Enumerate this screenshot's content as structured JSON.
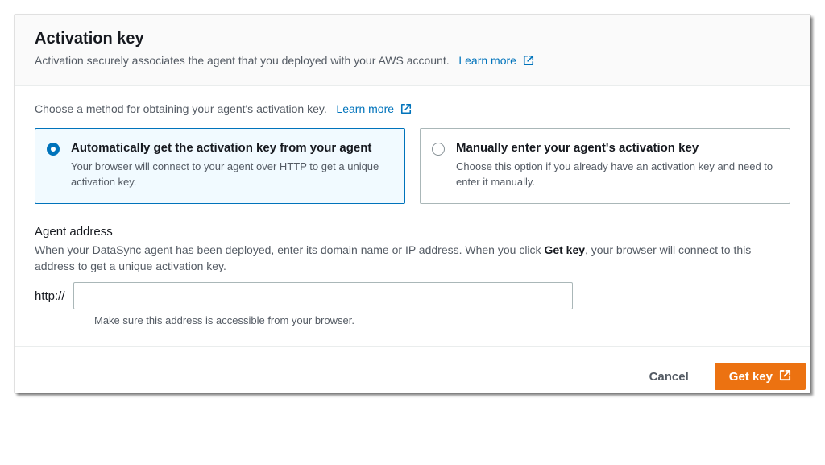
{
  "header": {
    "title": "Activation key",
    "subtitle": "Activation securely associates the agent that you deployed with your AWS account.",
    "learn_more": "Learn more"
  },
  "method": {
    "intro": "Choose a method for obtaining your agent's activation key.",
    "learn_more": "Learn more",
    "options": [
      {
        "title": "Automatically get the activation key from your agent",
        "desc": "Your browser will connect to your agent over HTTP to get a unique activation key.",
        "selected": true
      },
      {
        "title": "Manually enter your agent's activation key",
        "desc": "Choose this option if you already have an activation key and need to enter it manually.",
        "selected": false
      }
    ]
  },
  "agent_address": {
    "label": "Agent address",
    "help_pre": "When your DataSync agent has been deployed, enter its domain name or IP address. When you click ",
    "help_bold": "Get key",
    "help_post": ", your browser will connect to this address to get a unique activation key.",
    "prefix": "http://",
    "value": "",
    "hint": "Make sure this address is accessible from your browser."
  },
  "footer": {
    "cancel": "Cancel",
    "get_key": "Get key"
  },
  "colors": {
    "link": "#0073bb",
    "primary": "#ec7211",
    "text_muted": "#545b64",
    "border": "#aab7b8"
  }
}
